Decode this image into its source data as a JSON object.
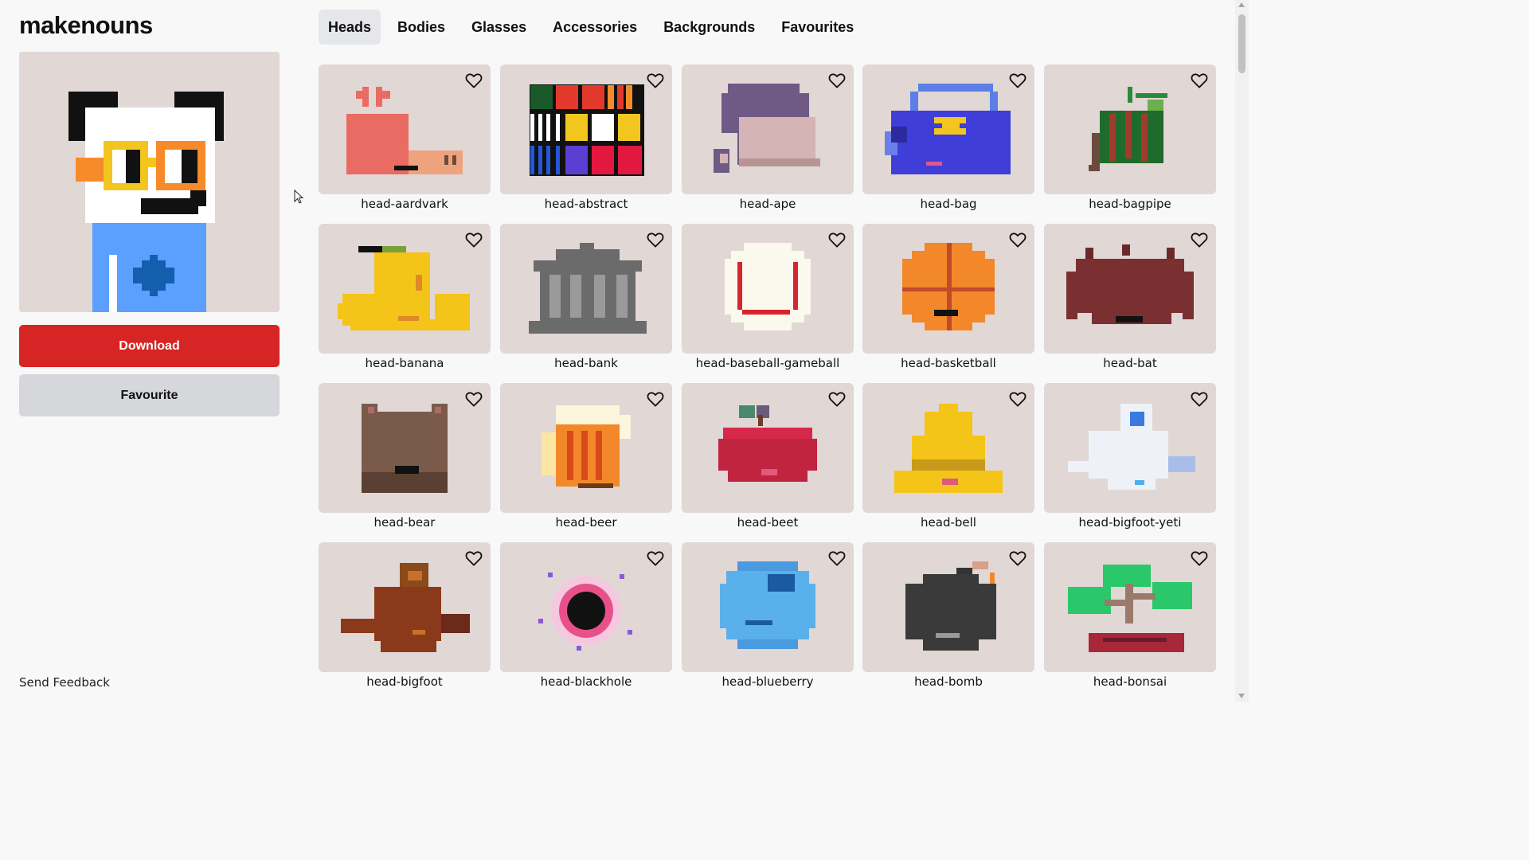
{
  "app": {
    "title": "makenouns"
  },
  "actions": {
    "download_label": "Download",
    "favourite_label": "Favourite"
  },
  "footer": {
    "feedback_label": "Send Feedback"
  },
  "tabs": [
    {
      "label": "Heads",
      "active": true
    },
    {
      "label": "Bodies",
      "active": false
    },
    {
      "label": "Glasses",
      "active": false
    },
    {
      "label": "Accessories",
      "active": false
    },
    {
      "label": "Backgrounds",
      "active": false
    },
    {
      "label": "Favourites",
      "active": false
    }
  ],
  "grid": {
    "items": [
      {
        "label": "head-aardvark",
        "art": "aardvark"
      },
      {
        "label": "head-abstract",
        "art": "abstract"
      },
      {
        "label": "head-ape",
        "art": "ape"
      },
      {
        "label": "head-bag",
        "art": "bag"
      },
      {
        "label": "head-bagpipe",
        "art": "bagpipe"
      },
      {
        "label": "head-banana",
        "art": "banana"
      },
      {
        "label": "head-bank",
        "art": "bank"
      },
      {
        "label": "head-baseball-gameball",
        "art": "baseball"
      },
      {
        "label": "head-basketball",
        "art": "basketball"
      },
      {
        "label": "head-bat",
        "art": "bat"
      },
      {
        "label": "head-bear",
        "art": "bear"
      },
      {
        "label": "head-beer",
        "art": "beer"
      },
      {
        "label": "head-beet",
        "art": "beet"
      },
      {
        "label": "head-bell",
        "art": "bell"
      },
      {
        "label": "head-bigfoot-yeti",
        "art": "yeti"
      },
      {
        "label": "head-bigfoot",
        "art": "bigfoot"
      },
      {
        "label": "head-blackhole",
        "art": "blackhole"
      },
      {
        "label": "head-blueberry",
        "art": "blueberry"
      },
      {
        "label": "head-bomb",
        "art": "bomb"
      },
      {
        "label": "head-bonsai",
        "art": "bonsai"
      }
    ]
  },
  "colors": {
    "tile_bg": "#e1d7d5",
    "download_bg": "#d72424",
    "favourite_bg": "#d5d7db",
    "active_tab_bg": "#e6e7ea"
  },
  "icons": {
    "favorite": "heart-outline-icon",
    "cursor": "mouse-pointer-icon"
  }
}
